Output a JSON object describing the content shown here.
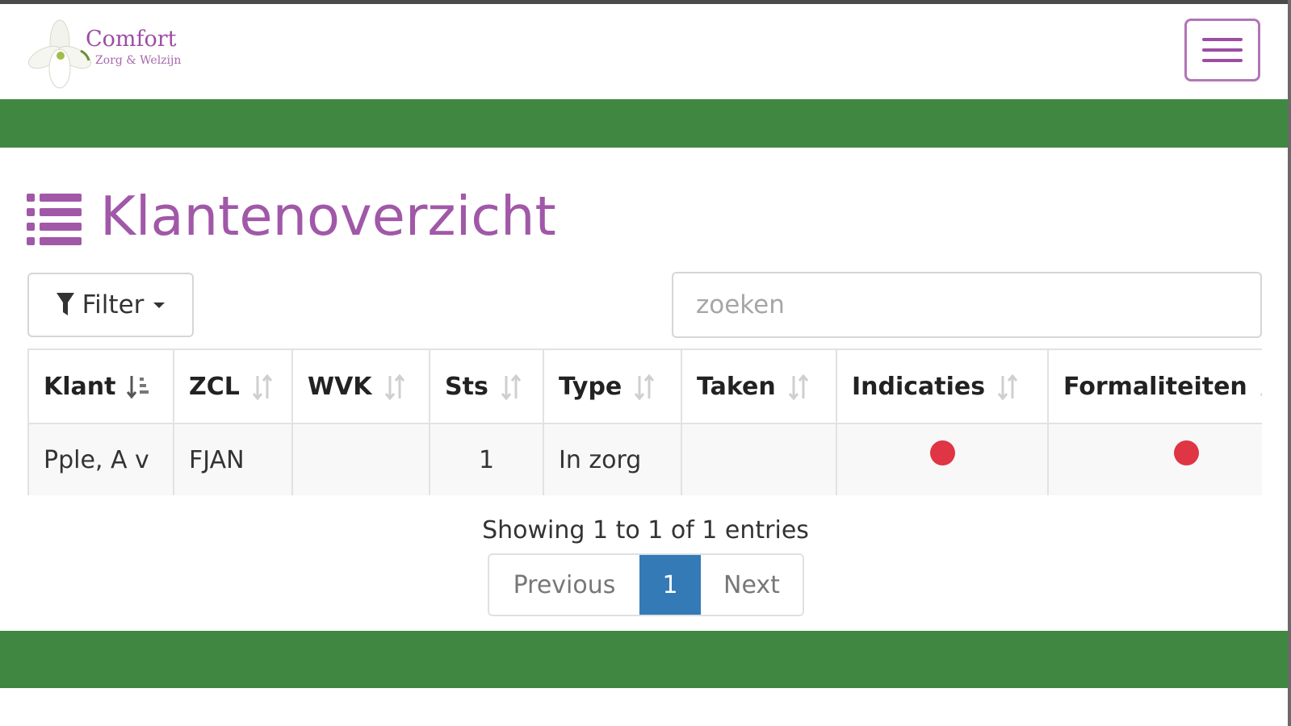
{
  "brand": {
    "name": "Comfort",
    "tagline": "Zorg & Welzijn"
  },
  "page": {
    "title": "Klantenoverzicht"
  },
  "toolbar": {
    "filter_label": "Filter",
    "search_placeholder": "zoeken"
  },
  "table": {
    "columns": [
      "Klant",
      "ZCL",
      "WVK",
      "Sts",
      "Type",
      "Taken",
      "Indicaties",
      "Formaliteiten"
    ],
    "rows": [
      {
        "klant": "Pple, A v",
        "zcl": "FJAN",
        "wvk": "",
        "sts": "1",
        "type": "In zorg",
        "taken": "",
        "indicaties_status": "red",
        "formaliteiten_status": "red"
      }
    ]
  },
  "pagination": {
    "info": "Showing 1 to 1 of 1 entries",
    "previous": "Previous",
    "current": "1",
    "next": "Next"
  },
  "colors": {
    "brand_purple": "#a158a8",
    "bar_green": "#408742",
    "status_red": "#df3544",
    "page_active": "#337ab7"
  }
}
